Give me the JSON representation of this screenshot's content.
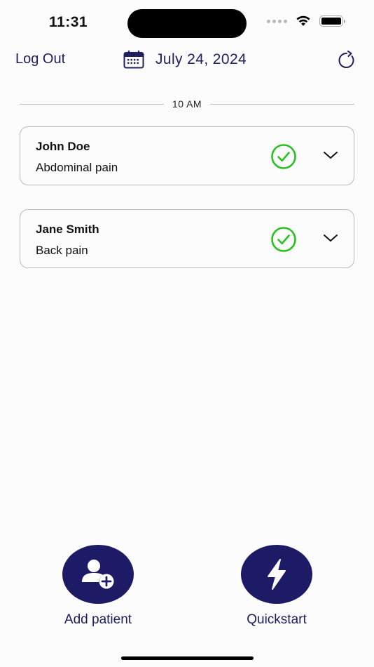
{
  "status_bar": {
    "time": "11:31"
  },
  "header": {
    "logout_label": "Log Out",
    "date": "July 24, 2024"
  },
  "schedule": {
    "time_slot": "10 AM",
    "patients": [
      {
        "name": "John Doe",
        "complaint": "Abdominal pain",
        "status": "completed"
      },
      {
        "name": "Jane Smith",
        "complaint": "Back pain",
        "status": "completed"
      }
    ]
  },
  "actions": {
    "add_patient_label": "Add patient",
    "quickstart_label": "Quickstart"
  },
  "colors": {
    "primary": "#1d1a66",
    "text_accent": "#1f2060",
    "success": "#27c21f",
    "border": "#b8b8b8"
  }
}
